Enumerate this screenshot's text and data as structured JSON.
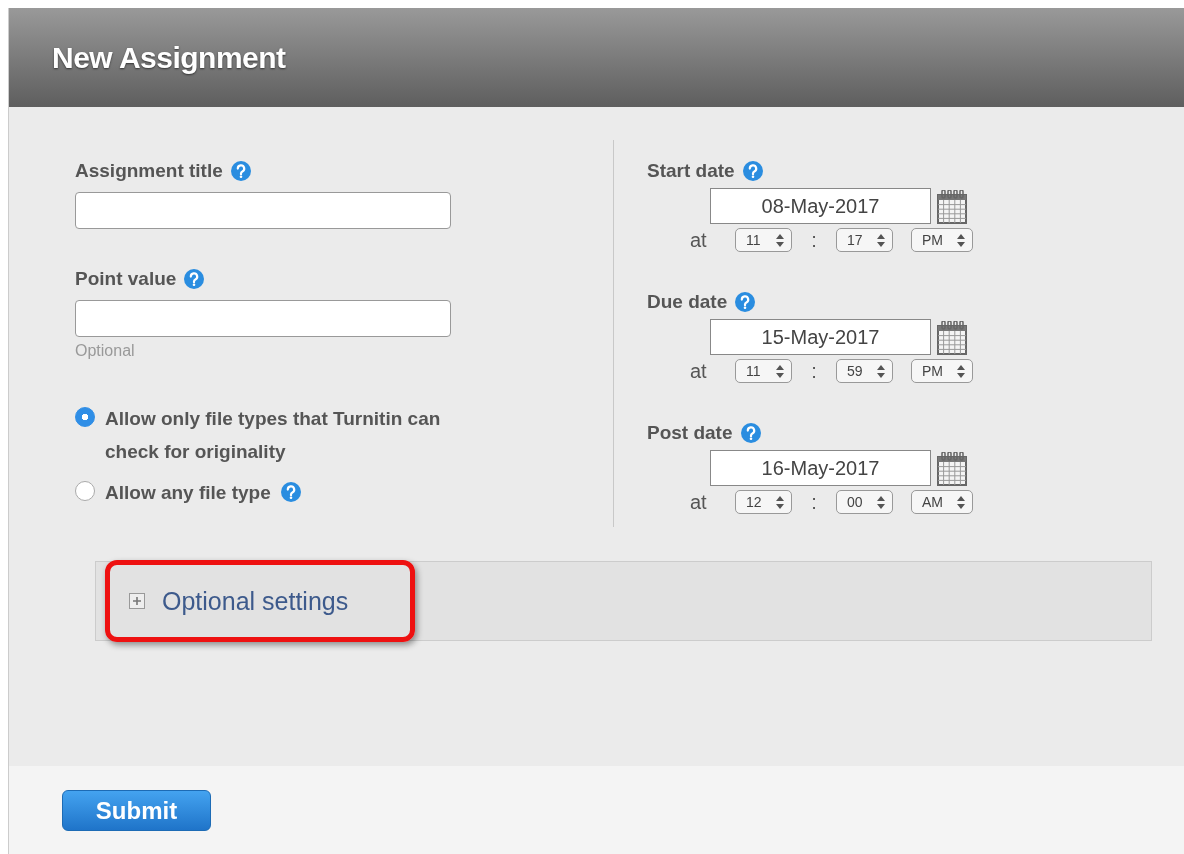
{
  "header": {
    "title": "New Assignment"
  },
  "fields": [
    {
      "label": "Assignment title",
      "help": true
    },
    {
      "label": "Point value",
      "help": true,
      "hint": "Optional"
    }
  ],
  "file_types": [
    {
      "label": "Allow only file types that Turnitin can check for originality",
      "selected": true,
      "help": false
    },
    {
      "label": "Allow any file type",
      "selected": false,
      "help": true
    }
  ],
  "dates": [
    {
      "label": "Start date",
      "help": true,
      "date": "08-May-2017",
      "at": "at",
      "hour": "11",
      "separator": ":",
      "minute": "17",
      "period": "PM"
    },
    {
      "label": "Due date",
      "help": true,
      "date": "15-May-2017",
      "at": "at",
      "hour": "11",
      "separator": ":",
      "minute": "59",
      "period": "PM"
    },
    {
      "label": "Post date",
      "help": true,
      "date": "16-May-2017",
      "at": "at",
      "hour": "12",
      "separator": ":",
      "minute": "00",
      "period": "AM"
    }
  ],
  "optional_settings": {
    "label": "Optional settings",
    "expanded": false,
    "highlighted": true
  },
  "submit": {
    "label": "Submit"
  }
}
